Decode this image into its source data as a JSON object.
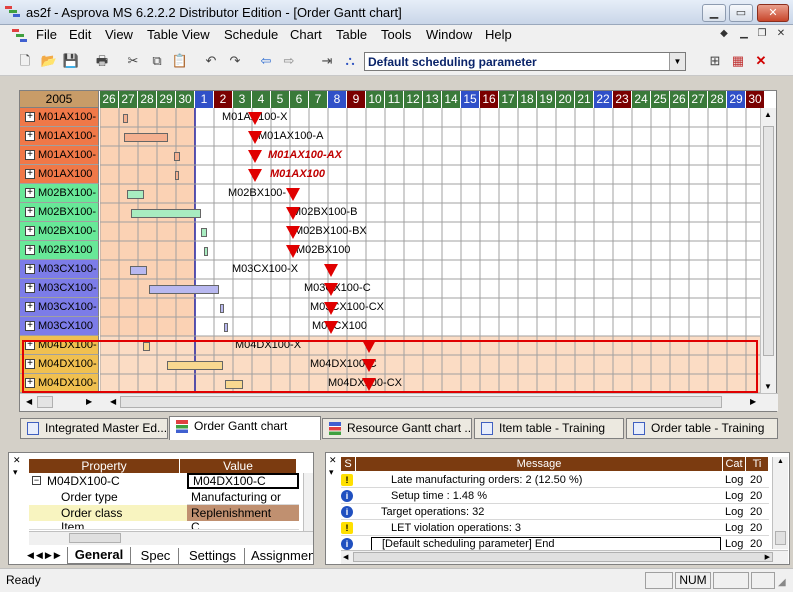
{
  "window": {
    "title": "as2f - Asprova MS 6.2.2.2 Distributor Edition  - [Order Gantt chart]"
  },
  "menu": [
    "File",
    "Edit",
    "View",
    "Table View",
    "Schedule",
    "Chart",
    "Table",
    "Tools",
    "Window",
    "Help"
  ],
  "toolbar": {
    "scheduling_parameter": "Default scheduling parameter"
  },
  "gantt": {
    "year": "2005",
    "days": [
      {
        "d": "26",
        "c": "#3a7a3a"
      },
      {
        "d": "27",
        "c": "#3a7a3a"
      },
      {
        "d": "28",
        "c": "#3a7a3a"
      },
      {
        "d": "29",
        "c": "#3a7a3a"
      },
      {
        "d": "30",
        "c": "#3a7a3a"
      },
      {
        "d": "1",
        "c": "#3050c8"
      },
      {
        "d": "2",
        "c": "#7a0000"
      },
      {
        "d": "3",
        "c": "#3a7a3a"
      },
      {
        "d": "4",
        "c": "#3a7a3a"
      },
      {
        "d": "5",
        "c": "#3a7a3a"
      },
      {
        "d": "6",
        "c": "#3a7a3a"
      },
      {
        "d": "7",
        "c": "#3a7a3a"
      },
      {
        "d": "8",
        "c": "#3050c8"
      },
      {
        "d": "9",
        "c": "#7a0000"
      },
      {
        "d": "10",
        "c": "#3a7a3a"
      },
      {
        "d": "11",
        "c": "#3a7a3a"
      },
      {
        "d": "12",
        "c": "#3a7a3a"
      },
      {
        "d": "13",
        "c": "#3a7a3a"
      },
      {
        "d": "14",
        "c": "#3a7a3a"
      },
      {
        "d": "15",
        "c": "#3050c8"
      },
      {
        "d": "16",
        "c": "#7a0000"
      },
      {
        "d": "17",
        "c": "#3a7a3a"
      },
      {
        "d": "18",
        "c": "#3a7a3a"
      },
      {
        "d": "19",
        "c": "#3a7a3a"
      },
      {
        "d": "20",
        "c": "#3a7a3a"
      },
      {
        "d": "21",
        "c": "#3a7a3a"
      },
      {
        "d": "22",
        "c": "#3050c8"
      },
      {
        "d": "23",
        "c": "#7a0000"
      },
      {
        "d": "24",
        "c": "#3a7a3a"
      },
      {
        "d": "25",
        "c": "#3a7a3a"
      },
      {
        "d": "26",
        "c": "#3a7a3a"
      },
      {
        "d": "27",
        "c": "#3a7a3a"
      },
      {
        "d": "28",
        "c": "#3a7a3a"
      },
      {
        "d": "29",
        "c": "#3050c8"
      },
      {
        "d": "30",
        "c": "#7a0000"
      }
    ],
    "rows": [
      {
        "label": "M01AX100-",
        "color": "#f07848",
        "task": "M01AX100-X",
        "red": false
      },
      {
        "label": "M01AX100-",
        "color": "#f07848",
        "task": "M01AX100-A",
        "red": false
      },
      {
        "label": "M01AX100-",
        "color": "#f07848",
        "task": "M01AX100-AX",
        "red": true
      },
      {
        "label": "M01AX100",
        "color": "#f07848",
        "task": "M01AX100",
        "red": true
      },
      {
        "label": "M02BX100-",
        "color": "#68e898",
        "task": "M02BX100-",
        "red": false
      },
      {
        "label": "M02BX100-",
        "color": "#68e898",
        "task": "M02BX100-B",
        "red": false
      },
      {
        "label": "M02BX100-",
        "color": "#68e898",
        "task": "M02BX100-BX",
        "red": false
      },
      {
        "label": "M02BX100",
        "color": "#68e898",
        "task": "M02BX100",
        "red": false
      },
      {
        "label": "M03CX100-",
        "color": "#7c7ce8",
        "task": "M03CX100-X",
        "red": false
      },
      {
        "label": "M03CX100-",
        "color": "#7c7ce8",
        "task": "M03CX100-C",
        "red": false
      },
      {
        "label": "M03CX100-",
        "color": "#7c7ce8",
        "task": "M03CX100-CX",
        "red": false
      },
      {
        "label": "M03CX100",
        "color": "#7c7ce8",
        "task": "M03CX100",
        "red": false
      },
      {
        "label": "M04DX100-",
        "color": "#f0c050",
        "task": "M04DX100-X",
        "red": false
      },
      {
        "label": "M04DX100-",
        "color": "#f0c050",
        "task": "M04DX100-C",
        "red": false
      },
      {
        "label": "M04DX100-",
        "color": "#f0c050",
        "task": "M04DX100-CX",
        "red": false
      }
    ]
  },
  "tabs": [
    "Integrated Master Ed...",
    "Order Gantt chart",
    "Resource Gantt chart ...",
    "Item table - Training",
    "Order table - Training"
  ],
  "property": {
    "col_property": "Property",
    "col_value": "Value",
    "rows": [
      {
        "k": "M04DX100-C",
        "v": "M04DX100-C"
      },
      {
        "k": "Order type",
        "v": "Manufacturing or"
      },
      {
        "k": "Order class",
        "v": "Replenishment"
      },
      {
        "k": "Item",
        "v": "C"
      }
    ],
    "tabs": [
      "General",
      "Spec",
      "Settings",
      "Assignment"
    ]
  },
  "log": {
    "col_s": "S",
    "col_message": "Message",
    "col_cat": "Cat",
    "col_ti": "Ti",
    "rows": [
      {
        "icon": "warn",
        "msg": "Late manufacturing orders: 2 (12.50 %)",
        "cat": "Log",
        "ti": "20"
      },
      {
        "icon": "info",
        "msg": "Setup time : 1.48 %",
        "cat": "Log",
        "ti": "20"
      },
      {
        "icon": "info",
        "msg": "Target operations: 32",
        "cat": "Log",
        "ti": "20"
      },
      {
        "icon": "warn",
        "msg": "LET violation operations: 3",
        "cat": "Log",
        "ti": "20"
      },
      {
        "icon": "info",
        "msg": "[Default scheduling parameter] End",
        "cat": "Log",
        "ti": "20"
      }
    ]
  },
  "status": {
    "ready": "Ready",
    "num": "NUM"
  }
}
